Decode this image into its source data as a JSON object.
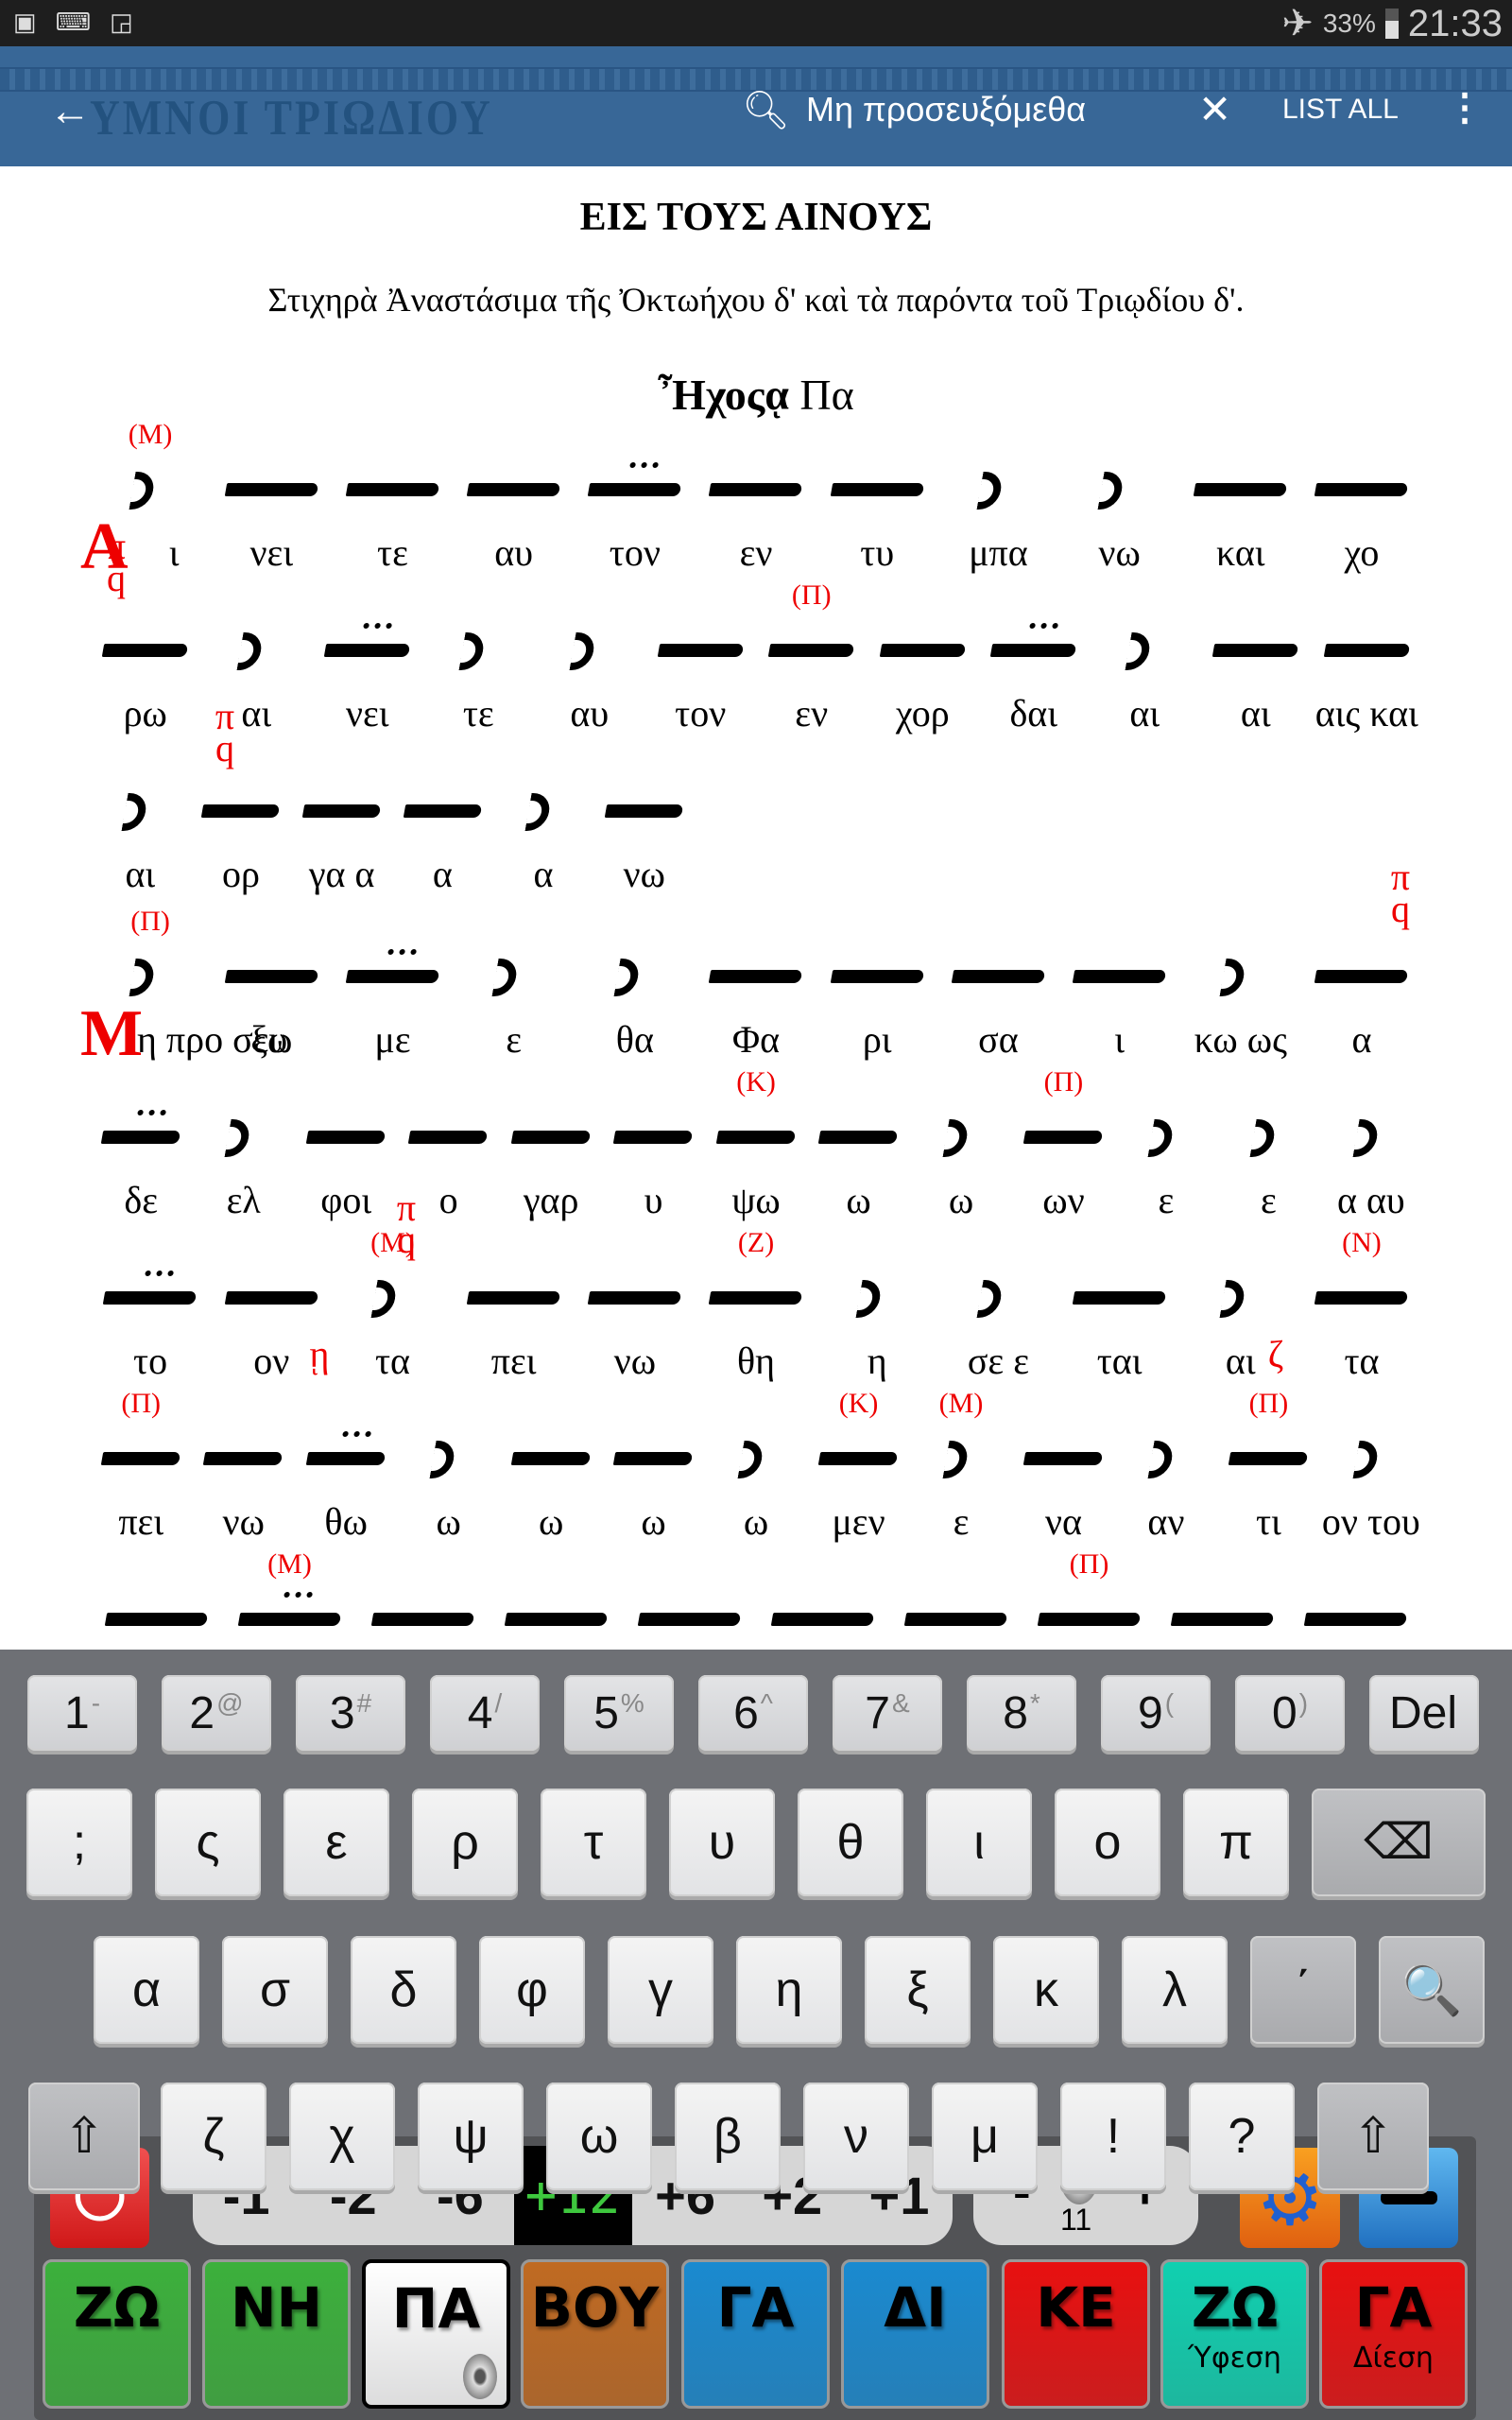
{
  "status": {
    "battery": "33%",
    "time": "21:33",
    "icons": [
      "gallery-icon",
      "keyboard-icon",
      "screen-clock-icon",
      "airplane-icon",
      "battery-icon"
    ]
  },
  "appbar": {
    "title": "ΥΜΝΟΙ ΤΡΙΩΔΙΟΥ",
    "search_query": "Μη προσευξόμεθα",
    "list_all": "LIST ALL"
  },
  "content": {
    "heading": "ΕΙΣ ΤΟΥΣ ΑΙΝΟΥΣ",
    "subheading": "Στιχηρὰ Ἀναστάσιμα τῆς Ὀκτωήχου δ' καὶ τὰ παρόντα τοῦ Τριῳδίου δ'.",
    "echos": "Ἦχος",
    "echos_sign": "ᾳ",
    "echos_pa": "Πα",
    "martyria": {
      "pi": "π",
      "q": "q",
      "eta": "ῃ",
      "zeta": "ζ"
    },
    "rows": [
      {
        "cells": [
          {
            "dc": "Α",
            "t": "ι",
            "n": "apo",
            "mk": "(Μ)"
          },
          {
            "t": "νει"
          },
          {
            "t": "τε"
          },
          {
            "t": "αυ"
          },
          {
            "t": "τον",
            "n": "ken"
          },
          {
            "t": "εν"
          },
          {
            "t": "τυ"
          },
          {
            "t": "μπα",
            "n": "apo"
          },
          {
            "t": "νω",
            "n": "apo"
          },
          {
            "t": "και"
          },
          {
            "t": "χο"
          }
        ]
      },
      {
        "cells": [
          {
            "t": "ρω"
          },
          {
            "t": "αι",
            "n": "apo"
          },
          {
            "t": "νει",
            "n": "ken"
          },
          {
            "t": "τε",
            "n": "apo"
          },
          {
            "t": "αυ",
            "n": "apo"
          },
          {
            "t": "τον"
          },
          {
            "t": "εν",
            "mk": "(Π)"
          },
          {
            "t": "χορ"
          },
          {
            "t": "δαι",
            "n": "ken"
          },
          {
            "t": "αι",
            "n": "apo"
          },
          {
            "t": "αι"
          },
          {
            "t": "αις και"
          }
        ]
      },
      {
        "cells": [
          {
            "t": "αι",
            "n": "apo"
          },
          {
            "t": "ορ"
          },
          {
            "t": "γα α"
          },
          {
            "t": "α"
          },
          {
            "t": "α",
            "n": "apo"
          },
          {
            "t": "νω"
          }
        ]
      },
      {
        "cells": [
          {
            "dc": "Μ",
            "t": "η προ σευ",
            "n": "apo",
            "mk": "(Π)"
          },
          {
            "t": "ξω"
          },
          {
            "t": "με",
            "n": "ken"
          },
          {
            "t": "ε",
            "n": "apo"
          },
          {
            "t": "θα",
            "n": "apo"
          },
          {
            "t": "Φα"
          },
          {
            "t": "ρι"
          },
          {
            "t": "σα"
          },
          {
            "t": "ι"
          },
          {
            "t": "κω ως",
            "n": "apo"
          },
          {
            "t": "α"
          }
        ]
      },
      {
        "cells": [
          {
            "t": "δε",
            "n": "ken"
          },
          {
            "t": "ελ",
            "n": "apo"
          },
          {
            "t": "φοι"
          },
          {
            "t": "ο"
          },
          {
            "t": "γαρ"
          },
          {
            "t": "υ"
          },
          {
            "t": "ψω",
            "mk": "(Κ)"
          },
          {
            "t": "ω"
          },
          {
            "t": "ω",
            "n": "apo"
          },
          {
            "t": "ων",
            "mk": "(Π)"
          },
          {
            "t": "ε",
            "n": "apo"
          },
          {
            "t": "ε",
            "n": "apo"
          },
          {
            "t": "α αυ",
            "n": "apo"
          }
        ]
      },
      {
        "cells": [
          {
            "t": "το",
            "n": "ken"
          },
          {
            "t": "ον"
          },
          {
            "t": "τα",
            "mk": "(Μ)",
            "n": "apo"
          },
          {
            "t": "πει"
          },
          {
            "t": "νω"
          },
          {
            "t": "θη",
            "mk": "(Ζ)"
          },
          {
            "t": "η",
            "n": "apo"
          },
          {
            "t": "σε ε",
            "n": "apo"
          },
          {
            "t": "ται"
          },
          {
            "t": "αι",
            "n": "apo"
          },
          {
            "t": "τα",
            "mk": "(Ν)"
          }
        ]
      },
      {
        "cells": [
          {
            "t": "πει",
            "mk": "(Π)"
          },
          {
            "t": "νω"
          },
          {
            "t": "θω",
            "n": "ken"
          },
          {
            "t": "ω",
            "n": "apo"
          },
          {
            "t": "ω"
          },
          {
            "t": "ω"
          },
          {
            "t": "ω",
            "n": "apo"
          },
          {
            "t": "μεν",
            "mk": "(Κ)"
          },
          {
            "t": "ε",
            "mk": "(Μ)",
            "n": "apo"
          },
          {
            "t": "να"
          },
          {
            "t": "αν",
            "n": "apo"
          },
          {
            "t": "τι",
            "mk": "(Π)"
          },
          {
            "t": "ον του",
            "n": "apo"
          }
        ]
      },
      {
        "cells": [
          {
            "t": ""
          },
          {
            "t": "",
            "mk": "(Μ)",
            "n": "ken"
          },
          {
            "t": ""
          },
          {
            "t": ""
          },
          {
            "t": ""
          },
          {
            "t": ""
          },
          {
            "t": ""
          },
          {
            "t": "",
            "mk": "(Π)"
          },
          {
            "t": ""
          },
          {
            "t": ""
          }
        ]
      }
    ]
  },
  "keyboard": {
    "row1": [
      [
        "1",
        "-"
      ],
      [
        "2",
        "@"
      ],
      [
        "3",
        "#"
      ],
      [
        "4",
        "/"
      ],
      [
        "5",
        "%"
      ],
      [
        "6",
        "^"
      ],
      [
        "7",
        "&"
      ],
      [
        "8",
        "*"
      ],
      [
        "9",
        "("
      ],
      [
        "0",
        ")"
      ],
      [
        "Del",
        ""
      ]
    ],
    "row2": [
      ";",
      "ς",
      "ε",
      "ρ",
      "τ",
      "υ",
      "θ",
      "ι",
      "ο",
      "π",
      "⌫"
    ],
    "row3": [
      "α",
      "σ",
      "δ",
      "φ",
      "γ",
      "η",
      "ξ",
      "κ",
      "λ",
      "΄",
      "🔍"
    ],
    "row4": [
      "⇧",
      "ζ",
      "χ",
      "ψ",
      "ω",
      "β",
      "ν",
      "μ",
      "!",
      "?",
      "⇧"
    ]
  },
  "toolbar": {
    "transpose": [
      "-1",
      "-2",
      "-6",
      "+12",
      "+6",
      "+2",
      "+1"
    ],
    "transpose_selected": "+12",
    "volume_minus": "-",
    "volume_plus": "+",
    "volume": "11",
    "modes": [
      {
        "label": "ΖΩ",
        "color": "#3cb03c"
      },
      {
        "label": "ΝΗ",
        "color": "#3cb03c"
      },
      {
        "label": "ΠΑ",
        "color": "#ffffff"
      },
      {
        "label": "ΒΟΥ",
        "color": "#c06a22"
      },
      {
        "label": "ΓΑ",
        "color": "#1a8ad0"
      },
      {
        "label": "ΔΙ",
        "color": "#1a8ad0"
      },
      {
        "label": "ΚΕ",
        "color": "#e81010"
      },
      {
        "label": "ΖΩ",
        "sub": "Ύφεση",
        "color": "#10d0b0"
      },
      {
        "label": "ΓΑ",
        "sub": "Δίεση",
        "color": "#e81010"
      }
    ],
    "selected_mode": "ΠΑ"
  }
}
